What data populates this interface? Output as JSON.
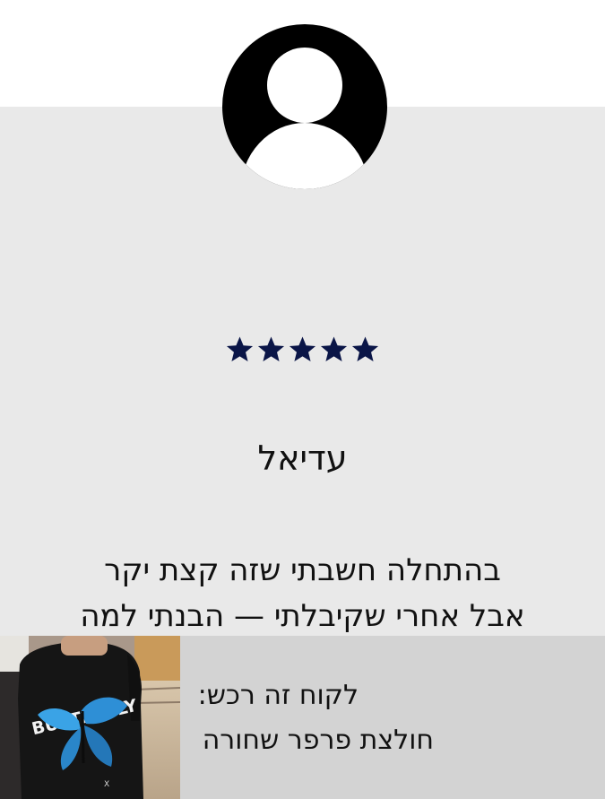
{
  "review": {
    "rating": 5,
    "rating_max": 5,
    "star_color": "#0a1547",
    "reviewer_name": "עדיאל",
    "text_line1": "בהתחלה חשבתי שזה קצת יקר",
    "text_line2": "אבל אחרי שקיבלתי — הבנתי למה"
  },
  "purchase": {
    "label": "לקוח זה רכש:",
    "product_name": "חולצת פרפר שחורה",
    "shirt_print_text": "BUTTERFLY"
  },
  "icons": {
    "avatar": "user-avatar-icon",
    "star": "star-icon"
  }
}
